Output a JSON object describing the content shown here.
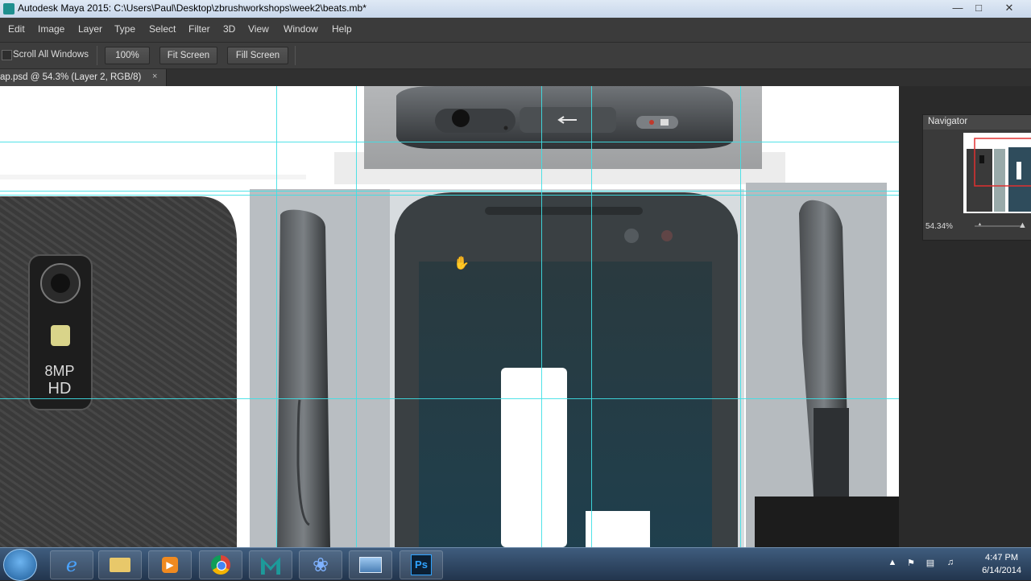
{
  "window": {
    "title": "Autodesk Maya 2015: C:\\Users\\Paul\\Desktop\\zbrushworkshops\\week2\\beats.mb*",
    "buttons": [
      "minimize",
      "maximize",
      "close"
    ]
  },
  "menu": {
    "items": [
      "Edit",
      "Image",
      "Layer",
      "Type",
      "Select",
      "Filter",
      "3D",
      "View",
      "Window",
      "Help"
    ]
  },
  "options": {
    "scroll_all_windows": "Scroll All Windows",
    "zoom_100": "100%",
    "fit_screen": "Fit Screen",
    "fill_screen": "Fill Screen"
  },
  "document": {
    "tab_label": "ap.psd @ 54.3% (Layer 2, RGB/8)",
    "close": "×",
    "camera_label_1": "8MP",
    "camera_label_2": "HD"
  },
  "navigator": {
    "title": "Navigator",
    "zoom": "54.34%"
  },
  "taskbar": {
    "time": "4:47 PM",
    "date": "6/14/2014",
    "apps": [
      "internet-explorer",
      "file-explorer",
      "media-player",
      "chrome",
      "maya",
      "zbrush",
      "image-viewer",
      "photoshop"
    ],
    "ps_label": "Ps"
  },
  "colors": {
    "guide": "#3ee0e6",
    "ps_blue": "#2fa3ff",
    "taskbar": "#2b4260"
  }
}
